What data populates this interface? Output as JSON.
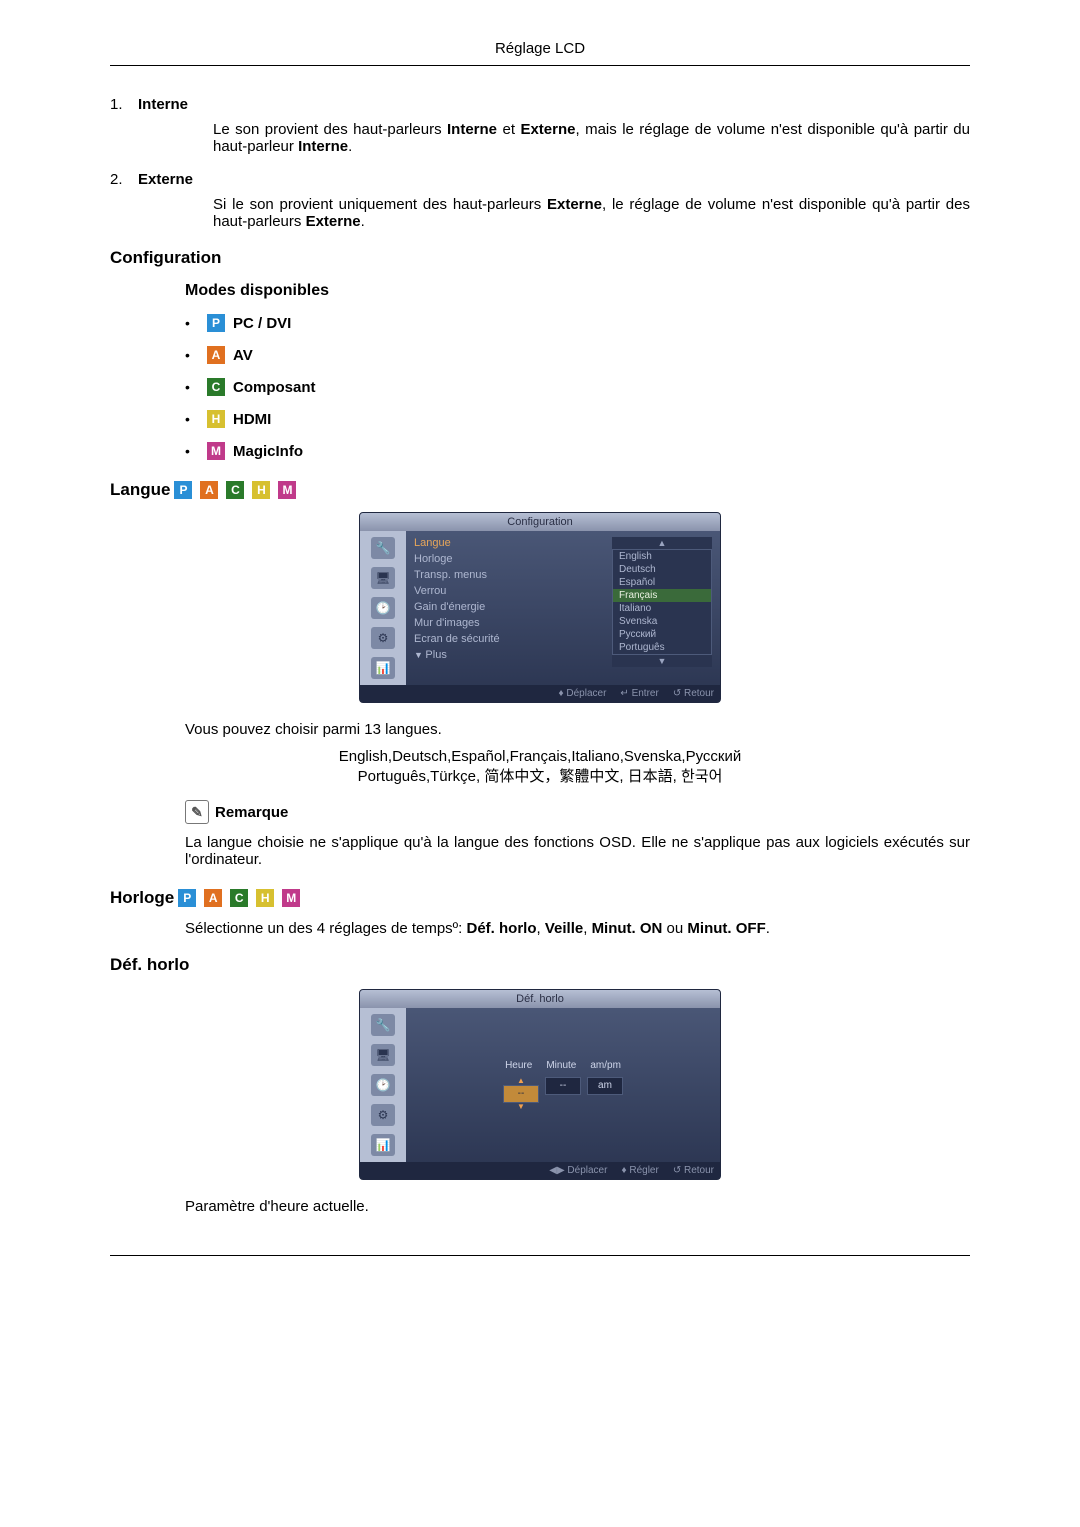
{
  "header": {
    "title": "Réglage LCD"
  },
  "list": {
    "items": [
      {
        "num": "1.",
        "label": "Interne",
        "body_parts": [
          "Le son provient des haut-parleurs ",
          "Interne",
          " et ",
          "Externe",
          ", mais le réglage de volume n'est disponible qu'à partir du haut-parleur ",
          "Interne",
          "."
        ]
      },
      {
        "num": "2.",
        "label": "Externe",
        "body_parts": [
          "Si le son provient uniquement des haut-parleurs ",
          "Externe",
          ", le réglage de volume n'est disponible qu'à partir des haut-parleurs ",
          "Externe",
          "."
        ]
      }
    ]
  },
  "config": {
    "heading": "Configuration",
    "modes_heading": "Modes disponibles",
    "modes": [
      {
        "letter": "P",
        "cls": "ic-p",
        "label": "PC / DVI"
      },
      {
        "letter": "A",
        "cls": "ic-a",
        "label": "AV"
      },
      {
        "letter": "C",
        "cls": "ic-c",
        "label": "Composant"
      },
      {
        "letter": "H",
        "cls": "ic-h",
        "label": "HDMI"
      },
      {
        "letter": "M",
        "cls": "ic-m",
        "label": "MagicInfo"
      }
    ]
  },
  "langue": {
    "heading": "Langue",
    "osd": {
      "title": "Configuration",
      "left": [
        "Langue",
        "Horloge",
        "Transp. menus",
        "Verrou",
        "Gain d'énergie",
        "Mur d'images",
        "Ecran de sécurité"
      ],
      "more": "Plus",
      "dd": [
        "English",
        "Deutsch",
        "Español",
        "Français",
        "Italiano",
        "Svenska",
        "Русский",
        "Português"
      ],
      "foot_move": "Déplacer",
      "foot_enter": "Entrer",
      "foot_return": "Retour"
    },
    "intro": "Vous pouvez choisir parmi 13 langues.",
    "langs_line1": "English,Deutsch,Español,Français,Italiano,Svenska,Русский",
    "langs_line2": "Português,Türkçe, 简体中文，繁體中文, 日本語, 한국어",
    "remark_label": "Remarque",
    "remark_body": "La langue choisie ne s'applique qu'à la langue des fonctions OSD. Elle ne s'applique pas aux logiciels exécutés sur l'ordinateur."
  },
  "horloge": {
    "heading": "Horloge",
    "intro_prefix": "Sélectionne un des 4 réglages de tempsº: ",
    "opts": [
      "Déf. horlo",
      "Veille",
      "Minut. ON",
      "Minut. OFF"
    ],
    "joins": [
      ", ",
      ", ",
      " ou "
    ],
    "suffix": "."
  },
  "defhorlo": {
    "heading": "Déf. horlo",
    "osd": {
      "title": "Déf. horlo",
      "cols": [
        "Heure",
        "Minute",
        "am/pm"
      ],
      "vals": [
        "--",
        "--",
        "am"
      ],
      "foot_move": "Déplacer",
      "foot_adjust": "Régler",
      "foot_return": "Retour"
    },
    "body": "Paramètre d'heure actuelle."
  },
  "icons_strip": [
    {
      "letter": "P",
      "cls": "ic-p"
    },
    {
      "letter": "A",
      "cls": "ic-a"
    },
    {
      "letter": "C",
      "cls": "ic-c"
    },
    {
      "letter": "H",
      "cls": "ic-h"
    },
    {
      "letter": "M",
      "cls": "ic-m"
    }
  ]
}
